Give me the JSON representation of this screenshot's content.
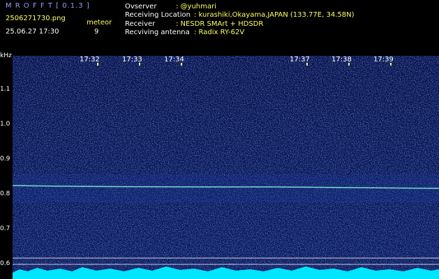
{
  "app": {
    "title": "M R O F F T [ 0.1.3 ]"
  },
  "file": {
    "name": "2506271730.png",
    "datetime": "25.06.27 17:30"
  },
  "meteor": {
    "label": "meteor",
    "count": "9"
  },
  "station": {
    "observer_label": "Ovserver",
    "observer_value": ": @yuhmari",
    "location_label": "Receiving Location",
    "location_value": ": kurashiki,Okayama,JAPAN (133.77E, 34.58N)",
    "receiver_label": "Receiver",
    "receiver_value": ": NESDR SMArt + HDSDR",
    "antenna_label": "Recviving antenna",
    "antenna_value": ": Radix RY-62V"
  },
  "axis": {
    "unit": "kHz",
    "ticks": [
      "1.1",
      "1.0",
      "0.9",
      "0.8",
      "0.7",
      "0.6"
    ],
    "time_labels": [
      "17:32",
      "17:33",
      "17:34",
      "17:37",
      "17:38",
      "17:39"
    ]
  },
  "colors": {
    "background": "#000000",
    "noise": "#1d2a7a",
    "signal": "#7fffd4",
    "band": "#00ffff",
    "title": "#8fa0ff",
    "info": "#ffff66"
  }
}
